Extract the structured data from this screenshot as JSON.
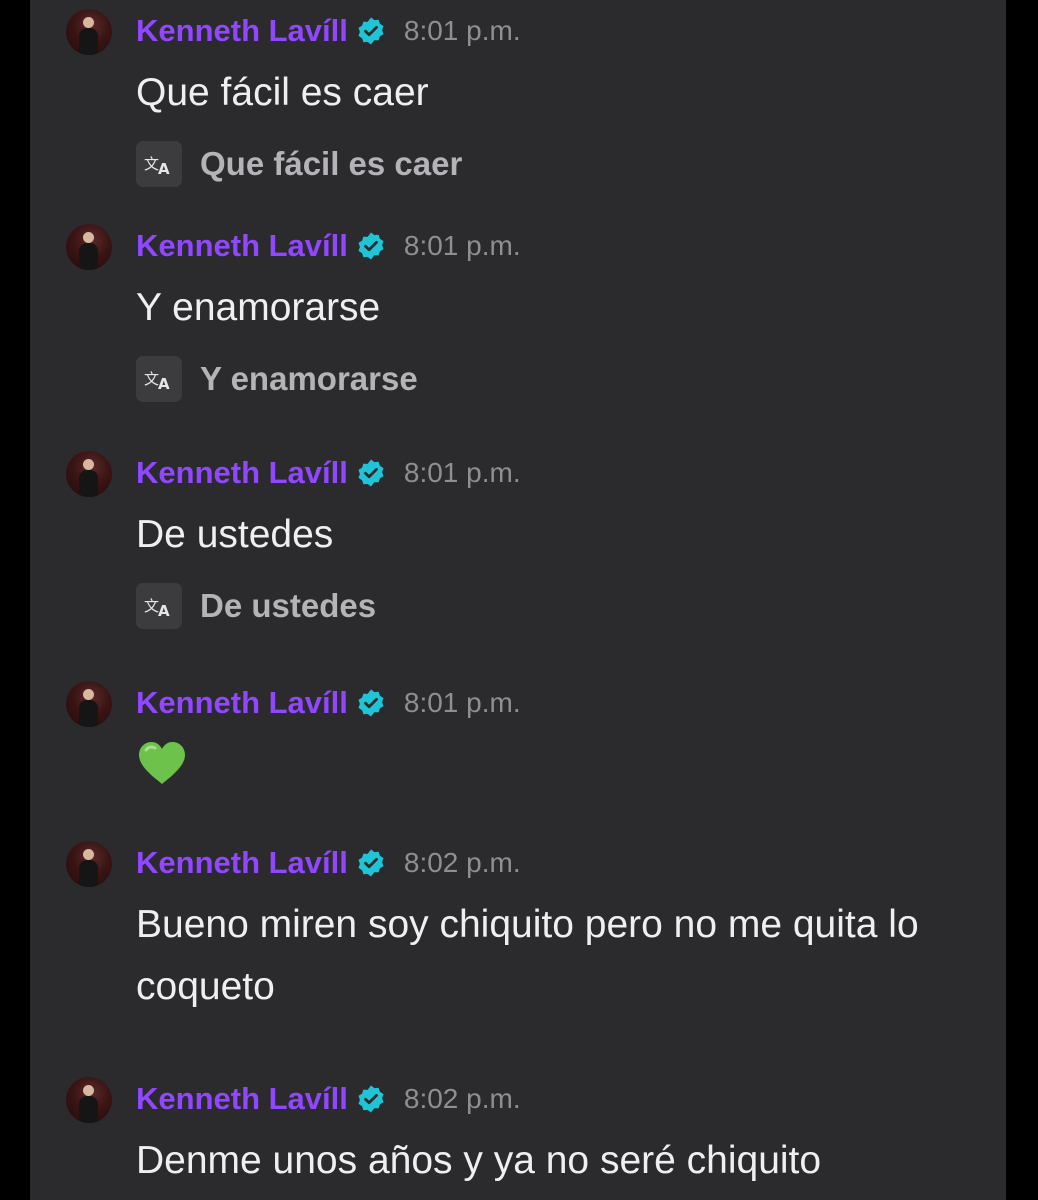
{
  "user": {
    "name": "Kenneth Lavíll",
    "avatar_icon": "user-avatar",
    "verified_icon": "verified-badge-icon",
    "name_color": "#9146ff",
    "badge_color": "#1fc5d6"
  },
  "translate_icon": "translate-icon",
  "messages": [
    {
      "time": "8:01 p.m.",
      "text": "Que fácil es caer",
      "translation": "Que fácil es caer"
    },
    {
      "time": "8:01 p.m.",
      "text": "Y enamorarse",
      "translation": "Y enamorarse"
    },
    {
      "time": "8:01 p.m.",
      "text": "De ustedes",
      "translation": "De ustedes"
    },
    {
      "time": "8:01 p.m.",
      "emoji": "green-heart-emoji"
    },
    {
      "time": "8:02 p.m.",
      "text": "Bueno miren soy chiquito pero no me quita lo coqueto"
    },
    {
      "time": "8:02 p.m.",
      "text": "Denme unos años y ya no seré chiquito"
    }
  ]
}
